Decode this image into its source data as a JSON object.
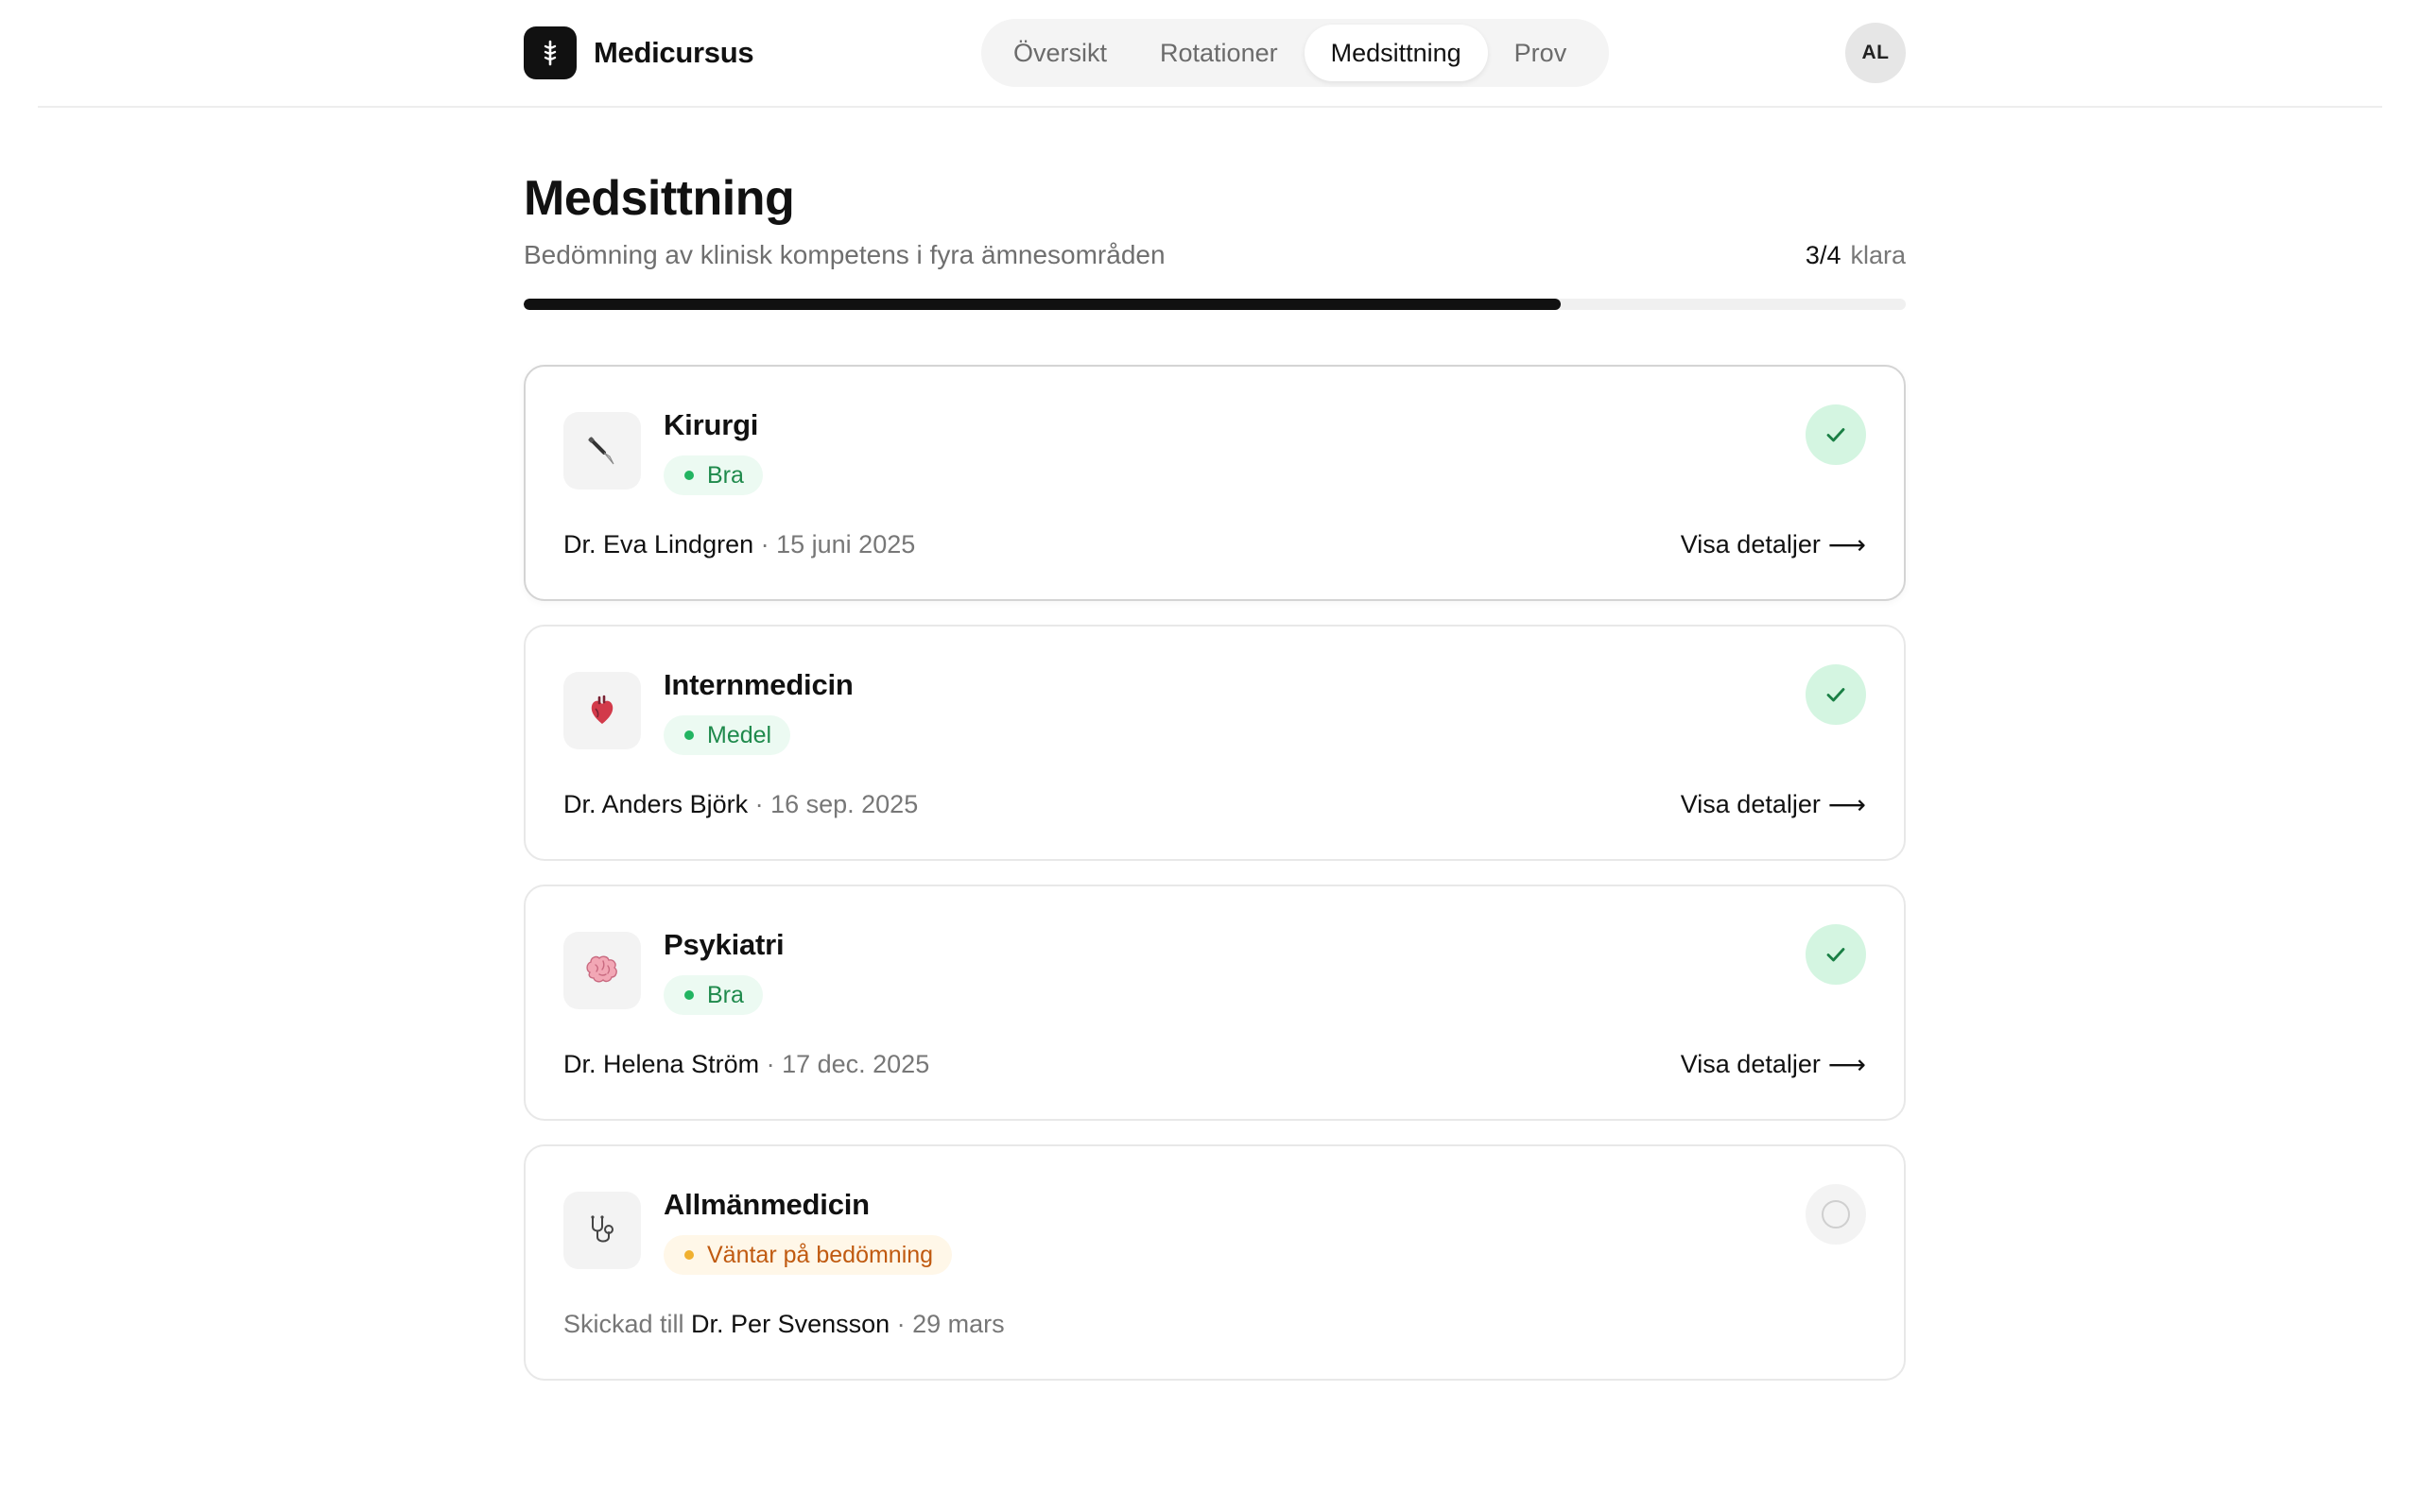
{
  "app": {
    "name": "Medicursus",
    "user_initials": "AL"
  },
  "nav": {
    "tabs": [
      {
        "label": "Översikt",
        "active": false
      },
      {
        "label": "Rotationer",
        "active": false
      },
      {
        "label": "Medsittning",
        "active": true
      },
      {
        "label": "Prov",
        "active": false
      }
    ]
  },
  "page": {
    "title": "Medsittning",
    "subtitle": "Bedömning av klinisk kompetens i fyra ämnesområden",
    "progress": {
      "count": "3/4",
      "word": "klara",
      "completed": 3,
      "total": 4,
      "fraction": 0.75
    }
  },
  "cards": [
    {
      "title": "Kirurgi",
      "icon": "scalpel-icon",
      "badge": "Bra",
      "badge_type": "good",
      "status": "done",
      "meta_prefix": "",
      "doctor": "Dr. Eva Lindgren",
      "date": " · 15 juni 2025",
      "link": "Visa detaljer",
      "link_arrow": "⟶"
    },
    {
      "title": "Internmedicin",
      "icon": "heart-icon",
      "badge": "Medel",
      "badge_type": "good",
      "status": "done",
      "meta_prefix": "",
      "doctor": "Dr. Anders Björk",
      "date": " · 16 sep. 2025",
      "link": "Visa detaljer",
      "link_arrow": "⟶"
    },
    {
      "title": "Psykiatri",
      "icon": "brain-icon",
      "badge": "Bra",
      "badge_type": "good",
      "status": "done",
      "meta_prefix": "",
      "doctor": "Dr. Helena Ström",
      "date": " · 17 dec. 2025",
      "link": "Visa detaljer",
      "link_arrow": "⟶"
    },
    {
      "title": "Allmänmedicin",
      "icon": "stethoscope-icon",
      "badge": "Väntar på bedömning",
      "badge_type": "pending",
      "status": "todo",
      "meta_prefix": "Skickad till ",
      "doctor": "Dr. Per Svensson",
      "date": " · 29 mars",
      "link": "",
      "link_arrow": ""
    }
  ],
  "colors": {
    "accent": "#111111",
    "success_bg": "#d4f5e1",
    "success_text": "#1f8a4c",
    "pending_bg": "#fff7e8",
    "pending_text": "#c05a10"
  }
}
